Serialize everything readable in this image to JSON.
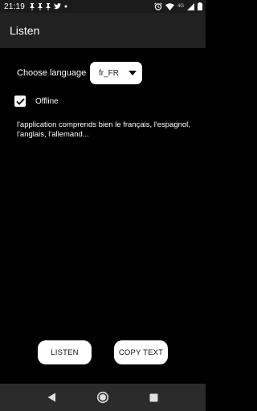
{
  "status_bar": {
    "time": "21:19",
    "left_icons": [
      "pin-icon",
      "pin-icon",
      "pin-icon",
      "twitter-icon",
      "dot-icon"
    ],
    "network_label": "4G",
    "right_icons": [
      "alarm-icon",
      "wifi-icon",
      "signal-icon",
      "battery-icon"
    ]
  },
  "app_bar": {
    "title": "Listen"
  },
  "language": {
    "label": "Choose language",
    "selected": "fr_FR"
  },
  "offline": {
    "label": "Offline",
    "checked": true
  },
  "info": {
    "text": "l'application comprends bien le français, l'espagnol, l'anglais, l'allemand..."
  },
  "buttons": {
    "listen": "LISTEN",
    "copy_text": "COPY TEXT"
  },
  "nav": {
    "items": [
      "back-icon",
      "home-icon",
      "recents-icon"
    ]
  },
  "colors": {
    "background": "#000000",
    "app_bar": "#212121",
    "nav_bar": "#2b2b2b",
    "button": "#ffffff"
  }
}
